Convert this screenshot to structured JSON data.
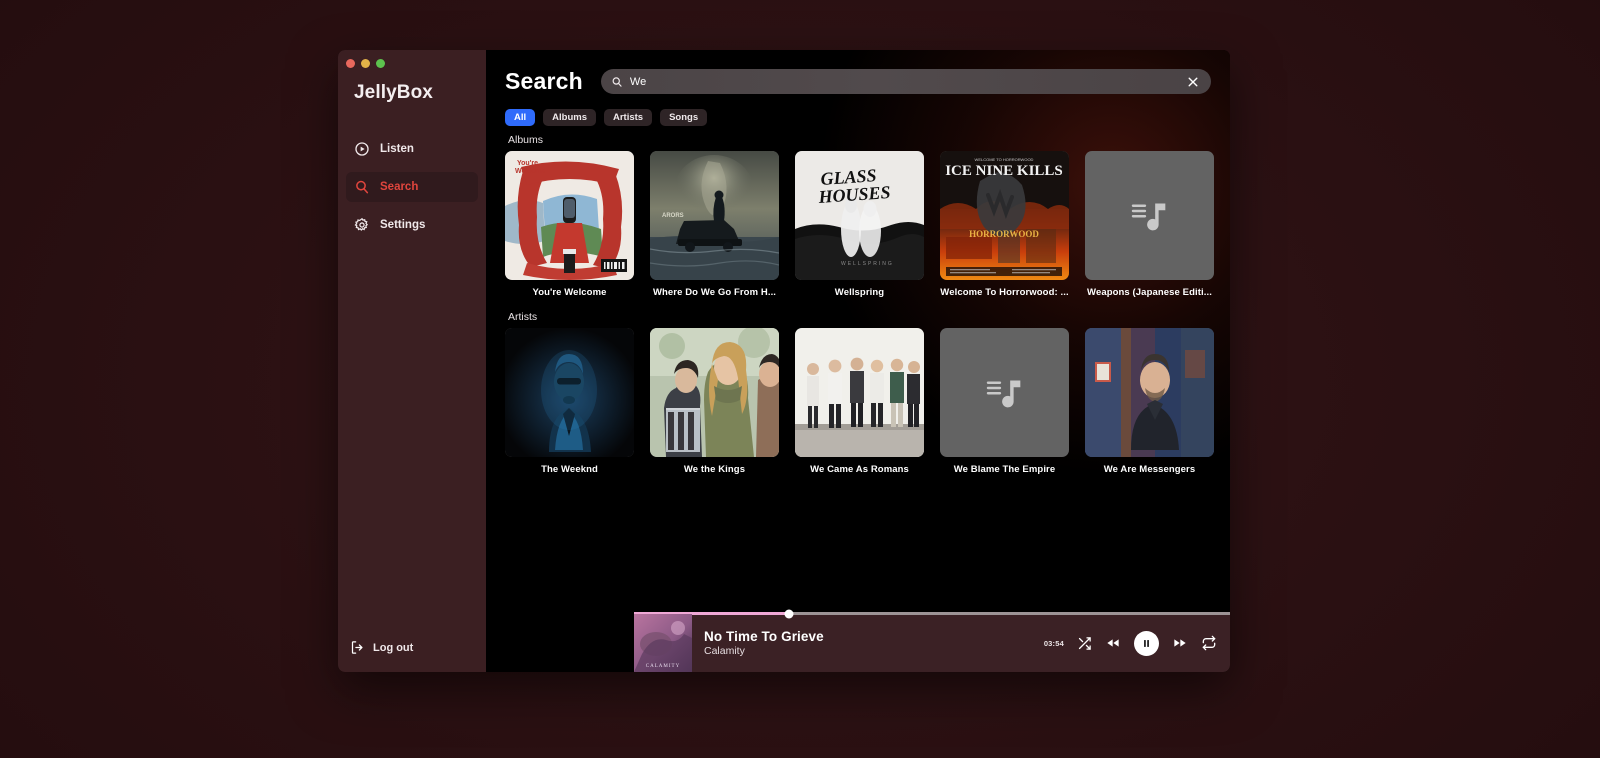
{
  "app": {
    "brand": "JellyBox",
    "window_controls": [
      "close",
      "minimize",
      "maximize"
    ]
  },
  "sidebar": {
    "items": [
      {
        "label": "Listen",
        "icon": "play-circle-icon",
        "active": false
      },
      {
        "label": "Search",
        "icon": "search-icon",
        "active": true
      },
      {
        "label": "Settings",
        "icon": "gear-icon",
        "active": false
      }
    ],
    "logout": {
      "label": "Log out",
      "icon": "logout-icon"
    }
  },
  "header": {
    "title": "Search",
    "search": {
      "value": "We",
      "placeholder": "Search",
      "icon": "search-icon",
      "clear_icon": "close-icon"
    }
  },
  "filters": {
    "options": [
      "All",
      "Albums",
      "Artists",
      "Songs"
    ],
    "selected": "All",
    "selected_color": "#2f6bfb"
  },
  "sections": [
    {
      "label": "Albums",
      "items": [
        {
          "title": "You're Welcome",
          "art": "youre-welcome"
        },
        {
          "title": "Where Do We Go From H...",
          "art": "where-do-we-go"
        },
        {
          "title": "Wellspring",
          "art": "wellspring"
        },
        {
          "title": "Welcome To Horrorwood: ...",
          "art": "horrorwood"
        },
        {
          "title": "Weapons (Japanese Editi...",
          "art": "placeholder"
        }
      ]
    },
    {
      "label": "Artists",
      "items": [
        {
          "title": "The Weeknd",
          "art": "the-weeknd"
        },
        {
          "title": "We the Kings",
          "art": "we-the-kings"
        },
        {
          "title": "We Came As Romans",
          "art": "we-came-as-romans"
        },
        {
          "title": "We Blame The Empire",
          "art": "placeholder"
        },
        {
          "title": "We Are Messengers",
          "art": "we-are-messengers"
        }
      ]
    }
  ],
  "player": {
    "track_title": "No Time To Grieve",
    "track_subtitle": "Calamity",
    "time": "03:54",
    "progress_percent": 26,
    "progress_color": "#f0a8d6",
    "controls": [
      {
        "name": "shuffle",
        "icon": "shuffle-icon"
      },
      {
        "name": "previous",
        "icon": "rewind-icon"
      },
      {
        "name": "playpause",
        "icon": "pause-icon"
      },
      {
        "name": "next",
        "icon": "fast-forward-icon"
      },
      {
        "name": "repeat",
        "icon": "repeat-icon"
      }
    ]
  }
}
